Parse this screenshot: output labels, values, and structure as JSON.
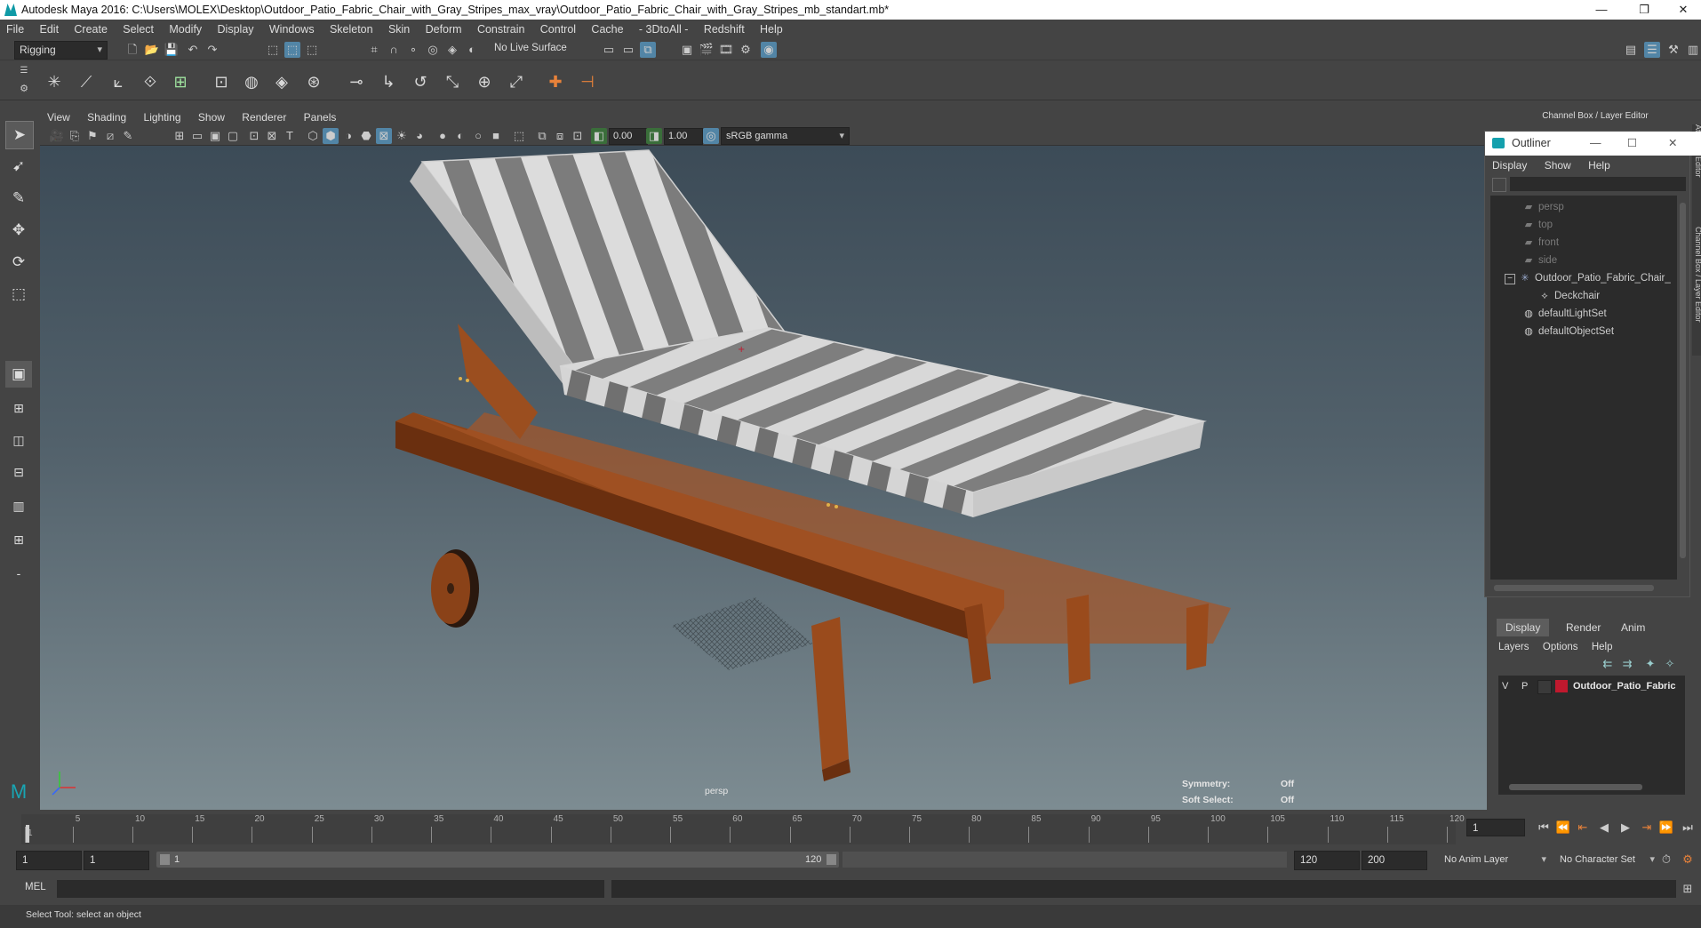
{
  "window": {
    "title": "Autodesk Maya 2016: C:\\Users\\MOLEX\\Desktop\\Outdoor_Patio_Fabric_Chair_with_Gray_Stripes_max_vray\\Outdoor_Patio_Fabric_Chair_with_Gray_Stripes_mb_standart.mb*",
    "minimize": "—",
    "restore": "❐",
    "close": "✕"
  },
  "menubar": [
    "File",
    "Edit",
    "Create",
    "Select",
    "Modify",
    "Display",
    "Windows",
    "Skeleton",
    "Skin",
    "Deform",
    "Constrain",
    "Control",
    "Cache",
    "- 3DtoAll -",
    "Redshift",
    "Help"
  ],
  "statusline": {
    "menuset": "Rigging",
    "live_surface": "No Live Surface"
  },
  "viewport": {
    "menu": [
      "View",
      "Shading",
      "Lighting",
      "Show",
      "Renderer",
      "Panels"
    ],
    "exposure": "0.00",
    "gamma": "1.00",
    "colorspace": "sRGB gamma",
    "camera_label": "persp",
    "hud": {
      "symmetry_label": "Symmetry:",
      "symmetry_value": "Off",
      "soft_select_label": "Soft Select:",
      "soft_select_value": "Off"
    }
  },
  "channel_box": {
    "header": "Channel Box / Layer Editor",
    "side_tab_1": "Attribute Editor",
    "side_tab_2": "Channel Box / Layer Editor"
  },
  "outliner": {
    "title": "Outliner",
    "menu": [
      "Display",
      "Show",
      "Help"
    ],
    "items": [
      {
        "label": "persp",
        "icon": "camera-icon",
        "indent": 0,
        "dim": true
      },
      {
        "label": "top",
        "icon": "camera-icon",
        "indent": 0,
        "dim": true
      },
      {
        "label": "front",
        "icon": "camera-icon",
        "indent": 0,
        "dim": true
      },
      {
        "label": "side",
        "icon": "camera-icon",
        "indent": 0,
        "dim": true
      },
      {
        "label": "Outdoor_Patio_Fabric_Chair_",
        "icon": "transform-icon",
        "indent": 0,
        "dim": false,
        "expanded": true
      },
      {
        "label": "Deckchair",
        "icon": "mesh-icon",
        "indent": 1,
        "dim": false
      },
      {
        "label": "defaultLightSet",
        "icon": "set-icon",
        "indent": 0,
        "dim": false
      },
      {
        "label": "defaultObjectSet",
        "icon": "set-icon",
        "indent": 0,
        "dim": false
      }
    ]
  },
  "layer_editor": {
    "tabs": [
      "Display",
      "Render",
      "Anim"
    ],
    "active_tab": "Display",
    "menu": [
      "Layers",
      "Options",
      "Help"
    ],
    "layer": {
      "v": "V",
      "p": "P",
      "name": "Outdoor_Patio_Fabric",
      "color": "#c0192e"
    }
  },
  "timeline": {
    "ticks": [
      1,
      5,
      10,
      15,
      20,
      25,
      30,
      35,
      40,
      45,
      50,
      55,
      60,
      65,
      70,
      75,
      80,
      85,
      90,
      95,
      100,
      105,
      110,
      115,
      120
    ],
    "start": 1,
    "end": 120,
    "current_frame": "1"
  },
  "range": {
    "anim_start": "1",
    "playback_start": "1",
    "slider_start": "1",
    "slider_end": "120",
    "playback_end": "120",
    "anim_end": "200",
    "anim_layer": "No Anim Layer",
    "character_set": "No Character Set"
  },
  "cmdline": {
    "label": "MEL"
  },
  "helpline": {
    "text": "Select Tool: select an object"
  },
  "colors": {
    "fabric_light": "#d9d9d9",
    "fabric_dark": "#7b7b7b",
    "wood": "#9b4e1f",
    "accent": "#5285a6"
  }
}
